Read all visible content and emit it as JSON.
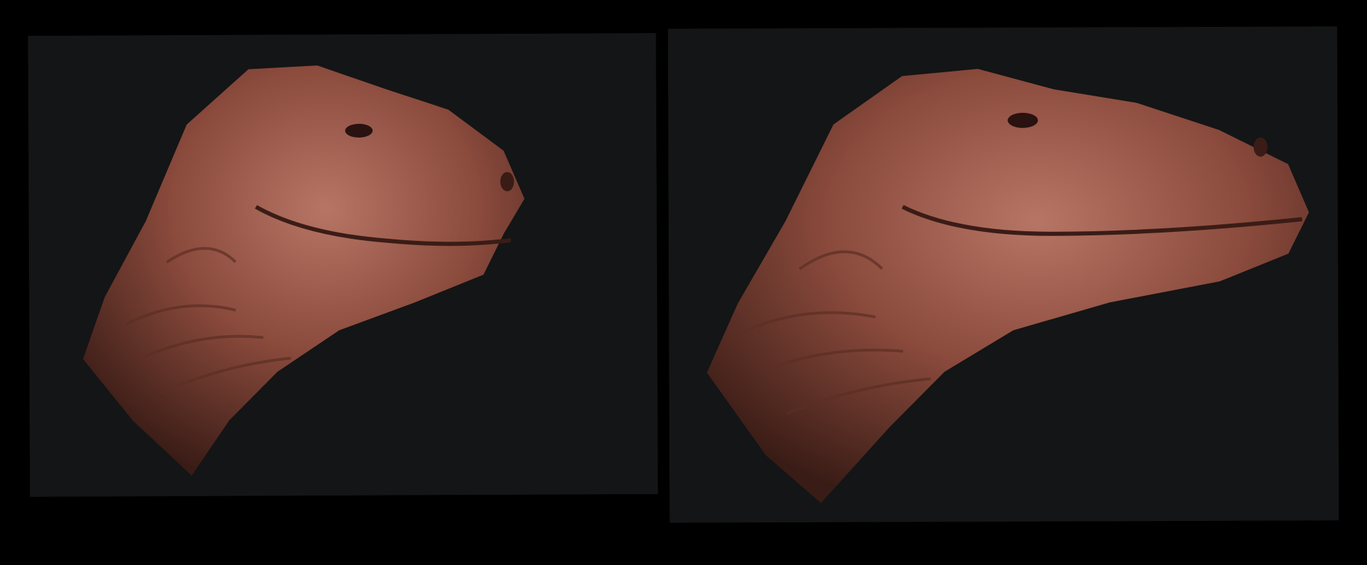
{
  "colors": {
    "background": "#000000",
    "panel": "#141516",
    "skin_light": "#b77565",
    "skin_mid": "#8a4a3c",
    "skin_dark": "#3a1c16"
  },
  "panels": [
    {
      "subject": "dinosaur-head-sculpt",
      "view": "three-quarter"
    },
    {
      "subject": "dinosaur-head-sculpt",
      "view": "three-quarter"
    }
  ]
}
